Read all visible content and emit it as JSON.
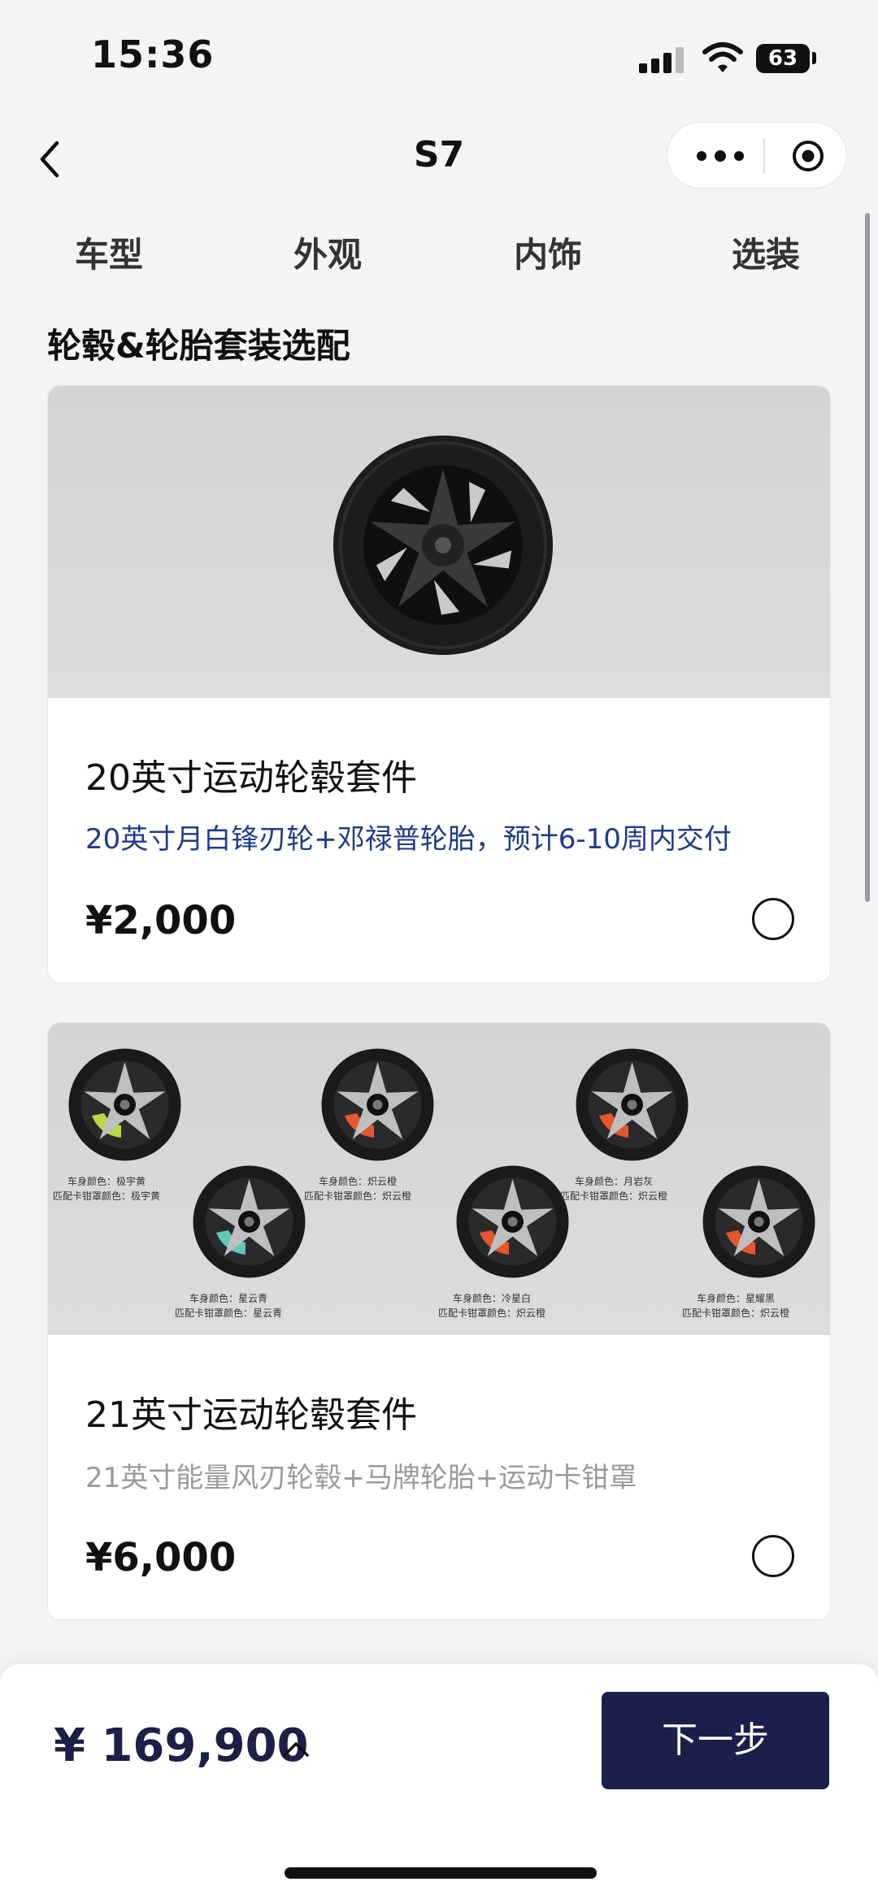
{
  "status_bar": {
    "time": "15:36",
    "battery": "63"
  },
  "nav": {
    "title": "S7"
  },
  "tabs": [
    "车型",
    "外观",
    "内饰",
    "选装"
  ],
  "section_title": "轮毂&轮胎套装选配",
  "options": [
    {
      "title": "20英寸运动轮毂套件",
      "description": "20英寸月白锋刃轮+邓禄普轮胎，预计6-10周内交付",
      "description_color": "#1f3a8a",
      "price": "¥2,000",
      "selected": false
    },
    {
      "title": "21英寸运动轮毂套件",
      "description": "21英寸能量风刃轮毂+马牌轮胎+运动卡钳罩",
      "description_color": "#9a9a9a",
      "price": "¥6,000",
      "selected": false,
      "variants": [
        {
          "line1": "车身颜色：极宇黄",
          "line2": "匹配卡钳罩颜色：极宇黄",
          "caliper": "#b9d84a"
        },
        {
          "line1": "车身颜色：星云青",
          "line2": "匹配卡钳罩颜色：星云青",
          "caliper": "#5fc9b8"
        },
        {
          "line1": "车身颜色：炽云橙",
          "line2": "匹配卡钳罩颜色：炽云橙",
          "caliper": "#e4572e"
        },
        {
          "line1": "车身颜色：冷星白",
          "line2": "匹配卡钳罩颜色：炽云橙",
          "caliper": "#e4572e"
        },
        {
          "line1": "车身颜色：月岩灰",
          "line2": "匹配卡钳罩颜色：炽云橙",
          "caliper": "#e4572e"
        },
        {
          "line1": "车身颜色：星耀黑",
          "line2": "匹配卡钳罩颜色：炽云橙",
          "caliper": "#e4572e"
        }
      ]
    }
  ],
  "bottom_bar": {
    "total_price": "¥ 169,900",
    "next_label": "下一步"
  },
  "colors": {
    "accent": "#1c1f4a",
    "page_bg": "#f4f4f7"
  }
}
